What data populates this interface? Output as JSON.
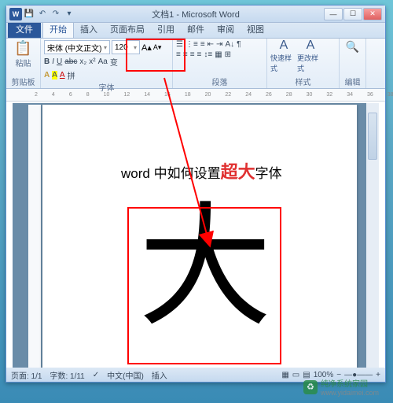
{
  "title": "文档1 - Microsoft Word",
  "tabs": {
    "file": "文件",
    "home": "开始",
    "insert": "插入",
    "layout": "页面布局",
    "ref": "引用",
    "mail": "邮件",
    "review": "审阅",
    "view": "视图"
  },
  "ribbon": {
    "clipboard": {
      "paste": "粘贴",
      "label": "剪贴板"
    },
    "font": {
      "family": "宋体 (中文正文)",
      "size": "120",
      "buttons": {
        "b": "B",
        "i": "I",
        "u": "U",
        "strike": "abc",
        "sub": "x₂",
        "sup": "x²",
        "grow": "A",
        "shrink": "A",
        "case": "Aa",
        "clear": "变",
        "effect": "A",
        "hilite": "A",
        "color": "A",
        "phonetic": "拼"
      },
      "label": "字体"
    },
    "paragraph": {
      "label": "段落"
    },
    "styles": {
      "quick": "快速样式",
      "change": "更改样式",
      "label": "样式"
    },
    "editing": {
      "label": "编辑"
    }
  },
  "document": {
    "headline_pre": "word 中如何设置",
    "headline_em": "超大",
    "headline_post": "字体",
    "big_char": "大"
  },
  "status": {
    "page": "页面: 1/1",
    "words": "字数: 1/11",
    "lang": "中文(中国)",
    "insert": "插入",
    "zoom": "100%"
  },
  "watermark": {
    "name": "纯净系统家园",
    "url": "www.yidaimei.com"
  }
}
